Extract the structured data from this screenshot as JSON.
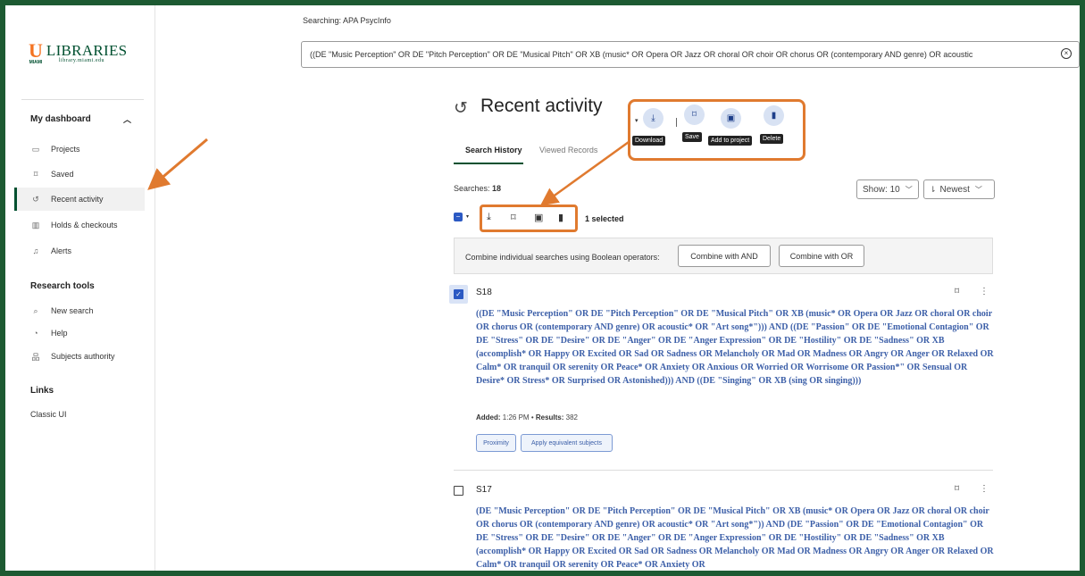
{
  "sidebar": {
    "logo": {
      "mark": "U",
      "mark_sub": "MIAMI",
      "title": "LIBRARIES",
      "subtitle": "library.miami.edu"
    },
    "dashboard_heading": "My dashboard",
    "dashboard_items": [
      {
        "label": "Projects",
        "icon": "folder-icon"
      },
      {
        "label": "Saved",
        "icon": "bookmark-icon"
      },
      {
        "label": "Recent activity",
        "icon": "history-icon"
      },
      {
        "label": "Holds & checkouts",
        "icon": "books-icon"
      },
      {
        "label": "Alerts",
        "icon": "bell-icon"
      }
    ],
    "research_heading": "Research tools",
    "research_items": [
      {
        "label": "New search",
        "icon": "search-icon"
      },
      {
        "label": "Help",
        "icon": "help-icon"
      },
      {
        "label": "Subjects authority",
        "icon": "hierarchy-icon"
      }
    ],
    "links_heading": "Links",
    "links_items": [
      {
        "label": "Classic UI"
      }
    ]
  },
  "search": {
    "label": "Searching:",
    "database": "APA PsycInfo",
    "query": "((DE \"Music Perception\" OR DE \"Pitch Perception\" OR DE \"Musical Pitch\" OR XB (music* OR Opera OR Jazz OR choral OR choir OR chorus OR (contemporary AND genre) OR acoustic"
  },
  "main": {
    "title": "Recent activity",
    "tabs": [
      {
        "label": "Search History"
      },
      {
        "label": "Viewed Records"
      }
    ],
    "callout": {
      "download": "Download",
      "save": "Save",
      "add_to_project": "Add to project",
      "delete": "Delete"
    },
    "searches_label": "Searches:",
    "searches_count": "18",
    "show_select": "Show: 10",
    "sort_select": "Newest",
    "selected_count": "1 selected",
    "combine": {
      "label": "Combine individual searches using Boolean operators:",
      "and_label": "Combine with AND",
      "or_label": "Combine with OR"
    },
    "results": [
      {
        "id": "S18",
        "checked": true,
        "query": "((DE \"Music Perception\" OR DE \"Pitch Perception\" OR DE \"Musical Pitch\" OR XB (music* OR Opera OR Jazz OR choral OR choir OR chorus OR (contemporary AND genre) OR acoustic* OR \"Art song*\"))) AND ((DE \"Passion\" OR DE \"Emotional Contagion\" OR DE \"Stress\" OR DE \"Desire\" OR DE \"Anger\" OR DE \"Anger Expression\" OR DE \"Hostility\" OR DE \"Sadness\" OR XB (accomplish* OR Happy OR Excited OR Sad OR Sadness OR Melancholy OR Mad OR Madness OR Angry OR Anger OR Relaxed OR Calm* OR tranquil OR serenity OR Peace* OR Anxiety OR Anxious OR Worried OR Worrisome OR Passion*\" OR Sensual OR Desire* OR Stress* OR Surprised OR Astonished))) AND ((DE \"Singing\" OR XB (sing OR singing)))",
        "added_label": "Added:",
        "added_time": "1:26 PM",
        "results_label": "Results:",
        "results_count": "382",
        "chips": [
          "Proximity",
          "Apply equivalent subjects"
        ]
      },
      {
        "id": "S17",
        "checked": false,
        "query": "(DE \"Music Perception\" OR DE \"Pitch Perception\" OR DE \"Musical Pitch\" OR XB (music* OR Opera OR Jazz OR choral OR choir OR chorus OR (contemporary AND genre) OR acoustic* OR \"Art song*\")) AND (DE \"Passion\" OR DE \"Emotional Contagion\" OR DE \"Stress\" OR DE \"Desire\" OR DE \"Anger\" OR DE \"Anger Expression\" OR DE \"Hostility\" OR DE \"Sadness\" OR XB (accomplish* OR Happy OR Excited OR Sad OR Sadness OR Melancholy OR Mad OR Madness OR Angry OR Anger OR Relaxed OR Calm* OR tranquil OR serenity OR Peace* OR Anxiety OR"
      }
    ]
  },
  "colors": {
    "accent": "#005030",
    "annotation": "#e07a2f",
    "link": "#3c5fa8",
    "brand_orange": "#f47321"
  }
}
